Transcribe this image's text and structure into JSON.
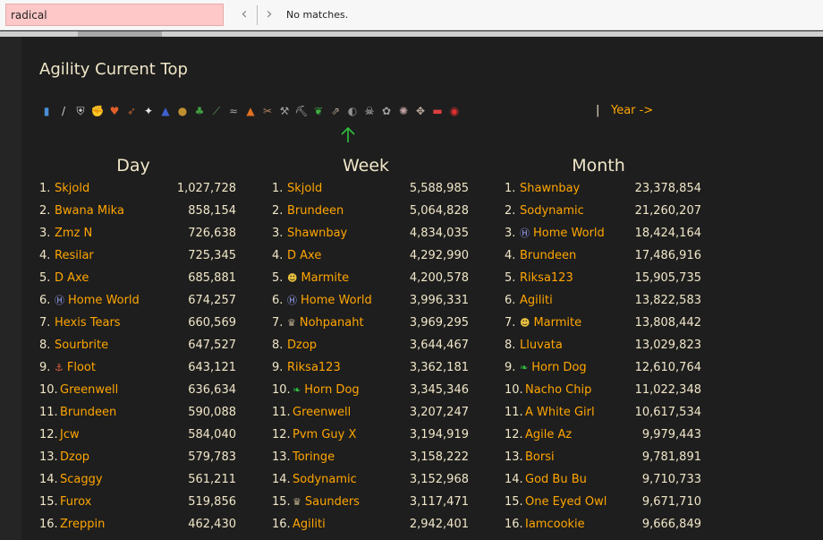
{
  "find_bar": {
    "query": "radical",
    "status": "No matches.",
    "prev_icon": "chevron-left-icon",
    "next_icon": "chevron-right-icon"
  },
  "title": "Agility Current Top",
  "skills": [
    {
      "name": "overall-icon",
      "glyph": "▮",
      "color": "#4a8fd8"
    },
    {
      "name": "attack-icon",
      "glyph": "/",
      "color": "#cfcfcf"
    },
    {
      "name": "defence-icon",
      "glyph": "⛨",
      "color": "#d8d8d8"
    },
    {
      "name": "strength-icon",
      "glyph": "✊",
      "color": "#d8b080"
    },
    {
      "name": "hitpoints-icon",
      "glyph": "♥",
      "color": "#e0602a"
    },
    {
      "name": "ranged-icon",
      "glyph": "➶",
      "color": "#b06030"
    },
    {
      "name": "prayer-icon",
      "glyph": "✦",
      "color": "#e8e8e8"
    },
    {
      "name": "magic-icon",
      "glyph": "▲",
      "color": "#4060d0"
    },
    {
      "name": "cooking-icon",
      "glyph": "●",
      "color": "#c09030"
    },
    {
      "name": "woodcutting-icon",
      "glyph": "♣",
      "color": "#40a040"
    },
    {
      "name": "fletching-icon",
      "glyph": "⟋",
      "color": "#60a060"
    },
    {
      "name": "fishing-icon",
      "glyph": "≈",
      "color": "#a0a0a0"
    },
    {
      "name": "firemaking-icon",
      "glyph": "▲",
      "color": "#e07020"
    },
    {
      "name": "crafting-icon",
      "glyph": "✂",
      "color": "#b08060"
    },
    {
      "name": "smithing-icon",
      "glyph": "⚒",
      "color": "#a0a0a0"
    },
    {
      "name": "mining-icon",
      "glyph": "⛏",
      "color": "#b0b0b0"
    },
    {
      "name": "herblore-icon",
      "glyph": "❦",
      "color": "#40b040"
    },
    {
      "name": "agility-icon",
      "glyph": "⇗",
      "color": "#b0a090"
    },
    {
      "name": "thieving-icon",
      "glyph": "◐",
      "color": "#909090"
    },
    {
      "name": "slayer-icon",
      "glyph": "☠",
      "color": "#d0d0d0"
    },
    {
      "name": "farming-icon",
      "glyph": "✿",
      "color": "#a0a0a0"
    },
    {
      "name": "runecrafting-icon",
      "glyph": "✺",
      "color": "#c0a0a0"
    },
    {
      "name": "hunter-icon",
      "glyph": "✥",
      "color": "#c0b0a0"
    },
    {
      "name": "construction-icon",
      "glyph": "▬",
      "color": "#e04040"
    },
    {
      "name": "ehp-icon",
      "glyph": "◉",
      "color": "#e03030"
    }
  ],
  "year_sep": "|",
  "year_link": "Year ->",
  "columns": [
    {
      "heading": "Day",
      "rows": [
        {
          "rank": "1.",
          "name": "Skjold",
          "score": "1,027,728"
        },
        {
          "rank": "2.",
          "name": "Bwana Mika",
          "score": "858,154"
        },
        {
          "rank": "3.",
          "name": "Zmz N",
          "score": "726,638"
        },
        {
          "rank": "4.",
          "name": "Resilar",
          "score": "725,345"
        },
        {
          "rank": "5.",
          "name": "D Axe",
          "score": "685,881"
        },
        {
          "rank": "6.",
          "name": "Home World",
          "score": "674,257",
          "icon": "home-world-icon"
        },
        {
          "rank": "7.",
          "name": "Hexis Tears",
          "score": "660,569"
        },
        {
          "rank": "8.",
          "name": "Sourbrite",
          "score": "647,527"
        },
        {
          "rank": "9.",
          "name": "Floot",
          "score": "643,121",
          "icon": "floot-icon"
        },
        {
          "rank": "10.",
          "name": "Greenwell",
          "score": "636,634"
        },
        {
          "rank": "11.",
          "name": "Brundeen",
          "score": "590,088"
        },
        {
          "rank": "12.",
          "name": "Jcw",
          "score": "584,040"
        },
        {
          "rank": "13.",
          "name": "Dzop",
          "score": "579,783"
        },
        {
          "rank": "14.",
          "name": "Scaggy",
          "score": "561,211"
        },
        {
          "rank": "15.",
          "name": "Furox",
          "score": "519,856"
        },
        {
          "rank": "16.",
          "name": "Zreppin",
          "score": "462,430"
        }
      ]
    },
    {
      "heading": "Week",
      "rows": [
        {
          "rank": "1.",
          "name": "Skjold",
          "score": "5,588,985"
        },
        {
          "rank": "2.",
          "name": "Brundeen",
          "score": "5,064,828"
        },
        {
          "rank": "3.",
          "name": "Shawnbay",
          "score": "4,834,035"
        },
        {
          "rank": "4.",
          "name": "D Axe",
          "score": "4,292,990"
        },
        {
          "rank": "5.",
          "name": "Marmite",
          "score": "4,200,578",
          "icon": "marmite-icon"
        },
        {
          "rank": "6.",
          "name": "Home World",
          "score": "3,996,331",
          "icon": "home-world-icon"
        },
        {
          "rank": "7.",
          "name": "Nohpanaht",
          "score": "3,969,295",
          "icon": "crown-icon"
        },
        {
          "rank": "8.",
          "name": "Dzop",
          "score": "3,644,467"
        },
        {
          "rank": "9.",
          "name": "Riksa123",
          "score": "3,362,181"
        },
        {
          "rank": "10.",
          "name": "Horn Dog",
          "score": "3,345,346",
          "icon": "leaf-icon"
        },
        {
          "rank": "11.",
          "name": "Greenwell",
          "score": "3,207,247"
        },
        {
          "rank": "12.",
          "name": "Pvm Guy X",
          "score": "3,194,919"
        },
        {
          "rank": "13.",
          "name": "Toringe",
          "score": "3,158,222"
        },
        {
          "rank": "14.",
          "name": "Sodynamic",
          "score": "3,152,968"
        },
        {
          "rank": "15.",
          "name": "Saunders",
          "score": "3,117,471",
          "icon": "crown-icon"
        },
        {
          "rank": "16.",
          "name": "Agiliti",
          "score": "2,942,401"
        }
      ]
    },
    {
      "heading": "Month",
      "rows": [
        {
          "rank": "1.",
          "name": "Shawnbay",
          "score": "23,378,854"
        },
        {
          "rank": "2.",
          "name": "Sodynamic",
          "score": "21,260,207"
        },
        {
          "rank": "3.",
          "name": "Home World",
          "score": "18,424,164",
          "icon": "home-world-icon"
        },
        {
          "rank": "4.",
          "name": "Brundeen",
          "score": "17,486,916"
        },
        {
          "rank": "5.",
          "name": "Riksa123",
          "score": "15,905,735"
        },
        {
          "rank": "6.",
          "name": "Agiliti",
          "score": "13,822,583"
        },
        {
          "rank": "7.",
          "name": "Marmite",
          "score": "13,808,442",
          "icon": "marmite-icon"
        },
        {
          "rank": "8.",
          "name": "Lluvata",
          "score": "13,029,823"
        },
        {
          "rank": "9.",
          "name": "Horn Dog",
          "score": "12,610,764",
          "icon": "leaf-icon"
        },
        {
          "rank": "10.",
          "name": "Nacho Chip",
          "score": "11,022,348"
        },
        {
          "rank": "11.",
          "name": "A White Girl",
          "score": "10,617,534"
        },
        {
          "rank": "12.",
          "name": "Agile Az",
          "score": "9,979,443"
        },
        {
          "rank": "13.",
          "name": "Borsi",
          "score": "9,781,891"
        },
        {
          "rank": "14.",
          "name": "God Bu Bu",
          "score": "9,710,733"
        },
        {
          "rank": "15.",
          "name": "One Eyed Owl",
          "score": "9,671,710"
        },
        {
          "rank": "16.",
          "name": "Iamcookie",
          "score": "9,666,849"
        }
      ]
    }
  ],
  "icon_glyphs": {
    "home-world-icon": {
      "glyph": "Ⓗ",
      "color": "#9aa6ff"
    },
    "floot-icon": {
      "glyph": "⚓",
      "color": "#e06040"
    },
    "marmite-icon": {
      "glyph": "☻",
      "color": "#e8c040"
    },
    "crown-icon": {
      "glyph": "♛",
      "color": "#c0b090"
    },
    "leaf-icon": {
      "glyph": "❧",
      "color": "#30c040"
    }
  },
  "colors": {
    "link": "#ffa500",
    "text": "#f0e6c8",
    "background": "#1e1e1e",
    "find_no_match": "#ffc8c8",
    "selected_arrow": "#30c040"
  }
}
